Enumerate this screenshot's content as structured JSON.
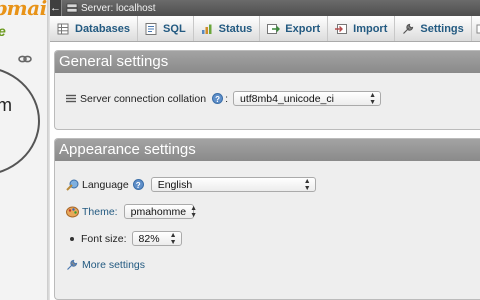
{
  "nav": {
    "logo_text": "pmain",
    "logo_sub": "e",
    "circle_letter": "m"
  },
  "server_bar": {
    "back_glyph": "←",
    "label": "Server: localhost"
  },
  "tabs": [
    {
      "label": "Databases",
      "icon": "database-icon"
    },
    {
      "label": "SQL",
      "icon": "sql-icon"
    },
    {
      "label": "Status",
      "icon": "status-icon"
    },
    {
      "label": "Export",
      "icon": "export-icon"
    },
    {
      "label": "Import",
      "icon": "import-icon"
    },
    {
      "label": "Settings",
      "icon": "wrench-icon"
    }
  ],
  "general": {
    "title": "General settings",
    "collation_label": "Server connection collation",
    "collation_value": "utf8mb4_unicode_ci"
  },
  "appearance": {
    "title": "Appearance settings",
    "language_label": "Language",
    "language_value": "English",
    "theme_label": "Theme:",
    "theme_value": "pmahomme",
    "fontsize_label": "Font size:",
    "fontsize_value": "82%",
    "more_settings": "More settings"
  },
  "colors": {
    "link": "#235a81",
    "header_gray": "#999999",
    "logo_orange": "#e89318"
  }
}
